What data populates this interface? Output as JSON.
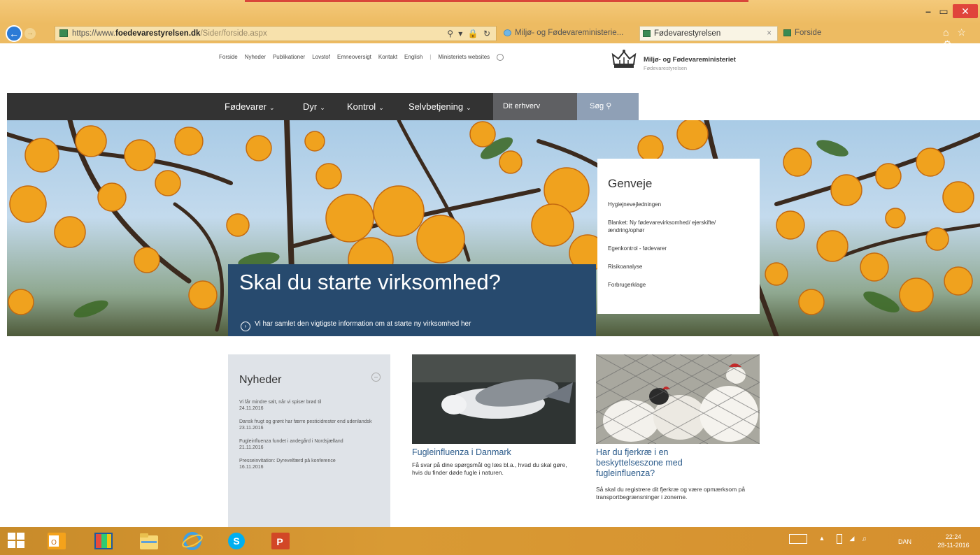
{
  "browser": {
    "url_prefix": "https://www.",
    "url_domain": "foedevarestyrelsen.dk",
    "url_path": "/Sider/forside.aspx",
    "address_icons": "⚲ ▾ 🔒 ↻",
    "tabs": [
      {
        "label": "Miljø- og Fødevareministerie..."
      },
      {
        "label": "Fødevarestyrelsen"
      },
      {
        "label": "Forside"
      }
    ],
    "tab_close": "×",
    "right_icons": "⌂ ☆ ⚙"
  },
  "window": {
    "min": "–",
    "max": "▭",
    "close": "✕"
  },
  "site": {
    "utility_nav": [
      "Forside",
      "Nyheder",
      "Publikationer",
      "Lovstof",
      "Emneoversigt",
      "Kontakt",
      "English",
      "Ministeriets websites"
    ],
    "logo_title": "Miljø- og Fødevareministeriet",
    "logo_subtitle": "Fødevarestyrelsen",
    "main_nav": [
      {
        "label": "Fødevarer"
      },
      {
        "label": "Dyr"
      },
      {
        "label": "Kontrol"
      },
      {
        "label": "Selvbetjening"
      }
    ],
    "nav_chevron": "⌄",
    "erhverv_label": "Dit erhverv",
    "search_label": "Søg"
  },
  "hero": {
    "title": "Skal du starte virksomhed?",
    "link": "Vi har samlet den vigtigste information om at starte ny virksomhed her"
  },
  "genveje": {
    "title": "Genveje",
    "links": [
      "Hygiejnevejledningen",
      "Blanket: Ny fødevarevirksomhed/ ejerskifte/ændring/ophør",
      "Egenkontrol - fødevarer",
      "Risikoanalyse",
      "Forbrugerklage"
    ]
  },
  "nyheder": {
    "title": "Nyheder",
    "items": [
      {
        "text": "Vi får mindre salt, når vi spiser brød til",
        "date": "24.11.2016"
      },
      {
        "text": "Dansk frugt og grønt har færre pesticidrester end udenlandsk",
        "date": "23.11.2016"
      },
      {
        "text": "Fugleinfluenza fundet i andegård i Nordsjælland",
        "date": "21.11.2016"
      },
      {
        "text": "Presseinvitation: Dyrevelfærd på konference",
        "date": "16.11.2016"
      }
    ]
  },
  "cards": [
    {
      "title": "Fugleinfluenza i Danmark",
      "text": "Få svar på dine spørgsmål og læs bl.a., hvad du skal gøre, hvis du finder døde fugle i naturen."
    },
    {
      "title": "Har du fjerkræ i en beskyttelseszone med fugleinfluenza?",
      "text": "Så skal du registrere dit fjerkræ og være opmærksom på transportbegrænsninger i zonerne."
    }
  ],
  "taskbar": {
    "language": "DAN",
    "time": "22:24",
    "date": "28-11-2016"
  }
}
